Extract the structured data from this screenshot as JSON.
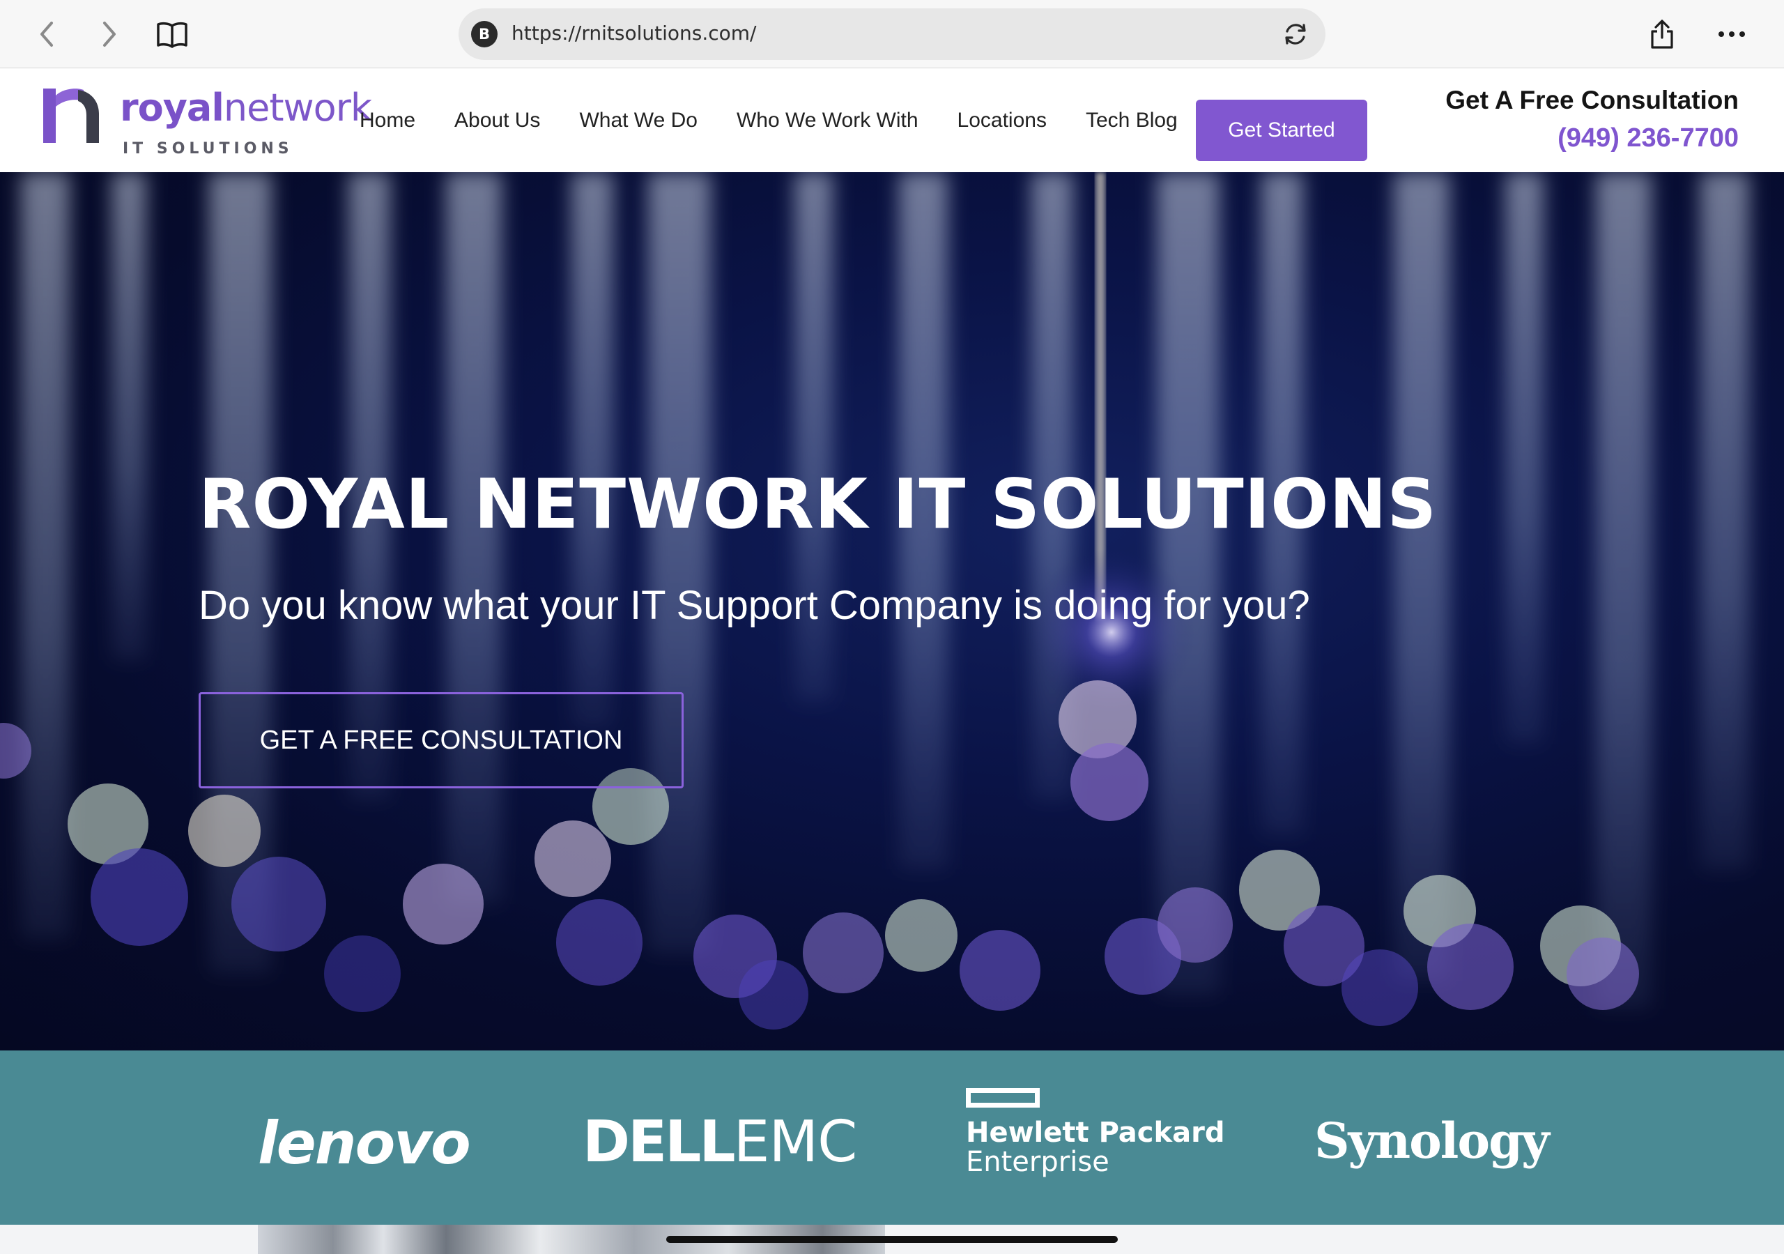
{
  "browser": {
    "site_badge": "B",
    "url": "https://rnitsolutions.com/",
    "icons": [
      "back-icon",
      "forward-icon",
      "bookmarks-icon",
      "reload-icon",
      "share-icon",
      "more-icon"
    ]
  },
  "logo": {
    "word_bold": "royal",
    "word_thin": "network",
    "tagline": "IT SOLUTIONS"
  },
  "nav": {
    "items": [
      "Home",
      "About Us",
      "What We Do",
      "Who We Work With",
      "Locations",
      "Tech Blog"
    ],
    "cta": "Get Started"
  },
  "contact": {
    "title": "Get A Free Consultation",
    "phone": "(949) 236-7700"
  },
  "hero": {
    "title": "ROYAL NETWORK IT SOLUTIONS",
    "subtitle": "Do you know what your IT Support Company is doing for you?",
    "cta": "GET A FREE CONSULTATION"
  },
  "partners": {
    "lenovo": "lenovo",
    "dell": "DELL",
    "emc": "EMC",
    "hpe_line1": "Hewlett Packard",
    "hpe_line2": "Enterprise",
    "synology": "Synology"
  },
  "colors": {
    "brand_purple": "#8157d0",
    "partner_strip": "#4a8a94",
    "hero_dark": "#0a1346"
  }
}
